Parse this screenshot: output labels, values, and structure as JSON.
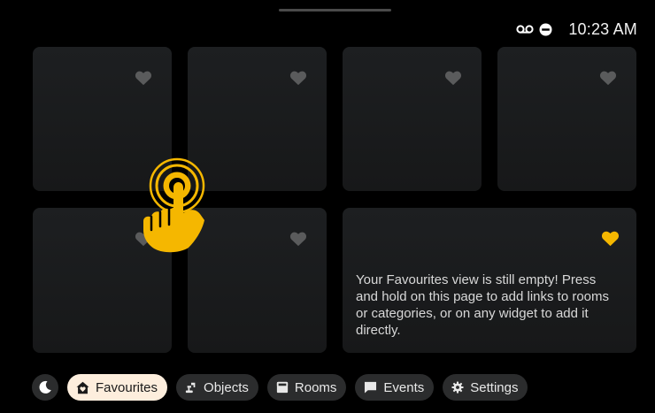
{
  "status": {
    "time": "10:23 AM",
    "icons": [
      "voicemail-icon",
      "do-not-disturb-icon"
    ]
  },
  "favourites": {
    "empty_message": "Your Favourites view is still empty! Press and hold on this page to add links to rooms or categories, or on any widget to add it directly.",
    "heart_color_inactive": "#5a5b5c",
    "heart_color_active": "#f5b700"
  },
  "nav": {
    "night_mode_icon": "moon-icon",
    "items": [
      {
        "label": "Favourites",
        "icon": "house-heart-icon",
        "active": true
      },
      {
        "label": "Objects",
        "icon": "lamp-icon",
        "active": false
      },
      {
        "label": "Rooms",
        "icon": "room-icon",
        "active": false
      },
      {
        "label": "Events",
        "icon": "chat-icon",
        "active": false
      },
      {
        "label": "Settings",
        "icon": "gear-icon",
        "active": false
      }
    ]
  },
  "colors": {
    "accent": "#f5b700",
    "active_pill": "#fdeedd",
    "pill": "#2b2c2d",
    "tile": "#1b1c1e",
    "background": "#000000"
  }
}
